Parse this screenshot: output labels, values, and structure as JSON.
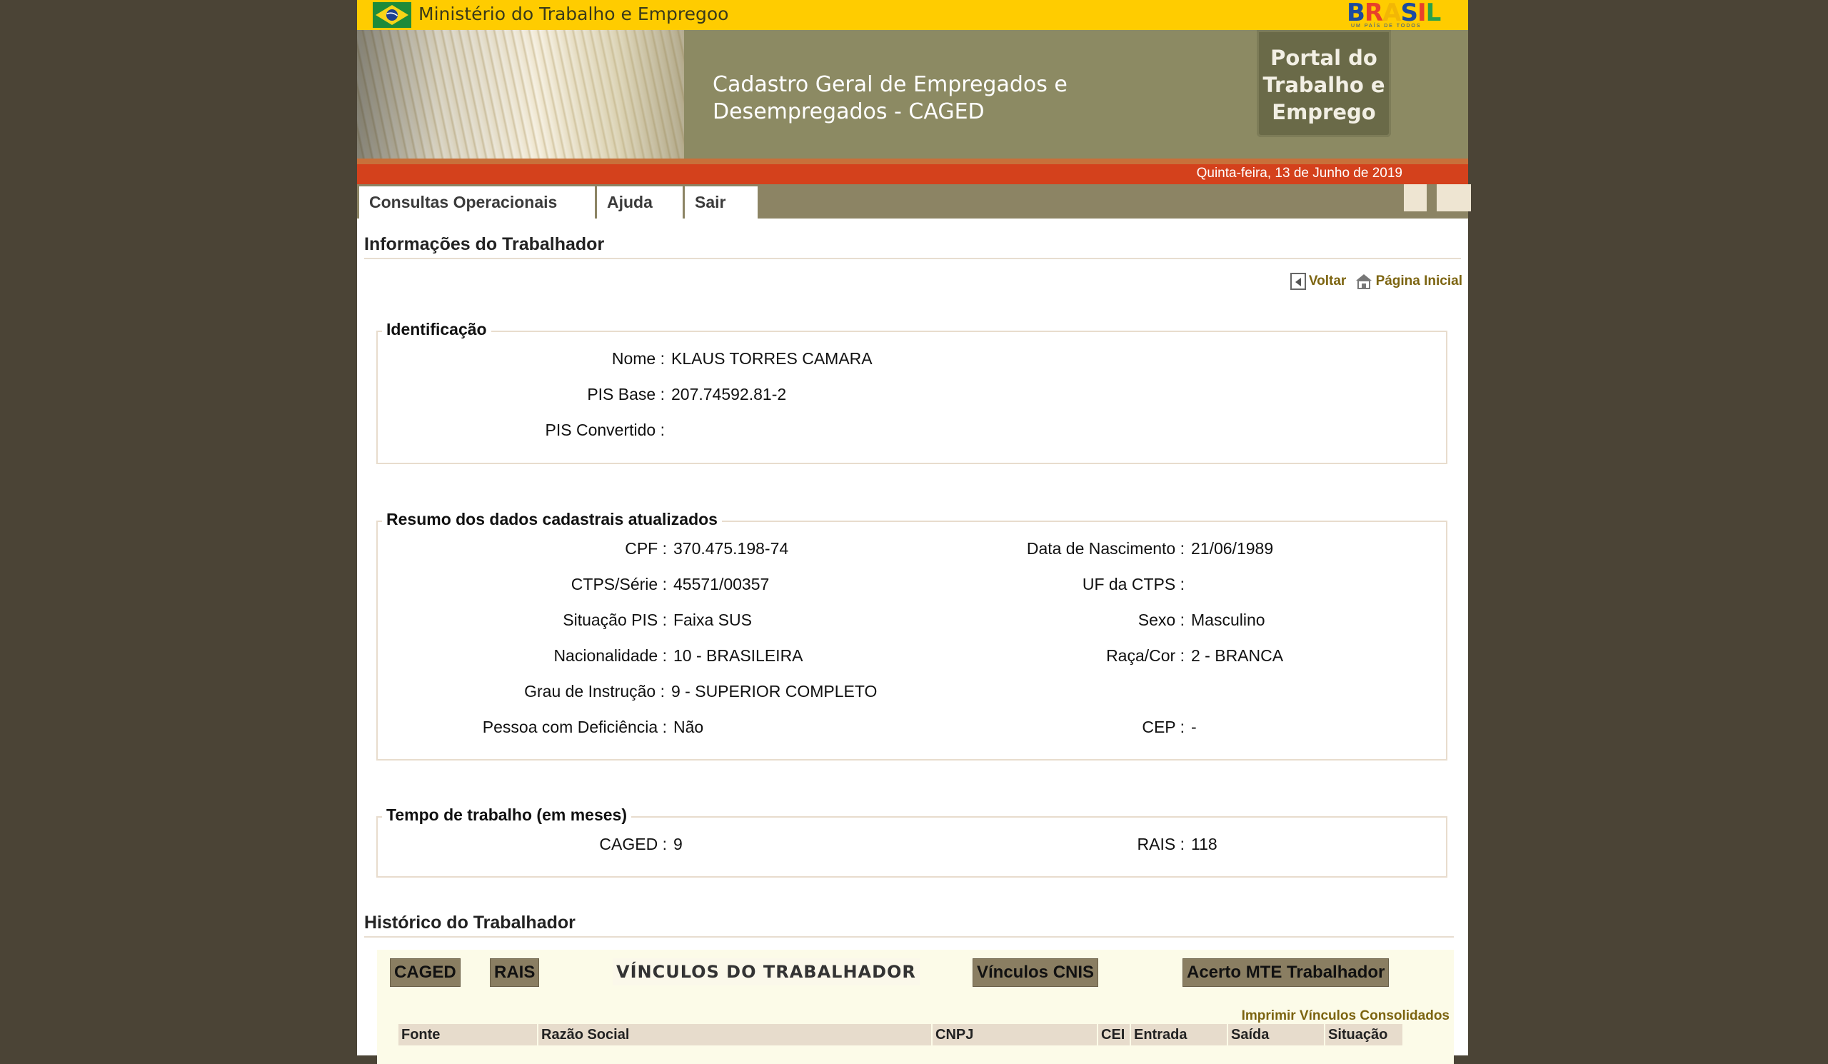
{
  "gov_bar": {
    "ministry": "Ministério do Trabalho e Empregoo",
    "brasil_logo": "BRASIL",
    "brasil_tagline": "UM PAÍS DE TODOS"
  },
  "header": {
    "system_title": "Cadastro Geral de Empregados e Desempregados - CAGED",
    "portal_label": "Portal do\nTrabalho e\nEmprego",
    "date": "Quinta-feira, 13 de Junho de 2019"
  },
  "menu": {
    "items": [
      "Consultas Operacionais",
      "Ajuda",
      "Sair"
    ]
  },
  "page": {
    "title": "Informações do Trabalhador",
    "back_label": "Voltar",
    "home_label": "Página Inicial"
  },
  "identificacao": {
    "legend": "Identificação",
    "fields": [
      {
        "label": "Nome :",
        "value": "KLAUS TORRES CAMARA"
      },
      {
        "label": "PIS Base :",
        "value": "207.74592.81-2"
      },
      {
        "label": "PIS Convertido :",
        "value": ""
      }
    ]
  },
  "resumo": {
    "legend": "Resumo dos dados cadastrais atualizados",
    "left": [
      {
        "label": "CPF :",
        "value": "370.475.198-74"
      },
      {
        "label": "CTPS/Série :",
        "value": "45571/00357"
      },
      {
        "label": "Situação PIS :",
        "value": "Faixa SUS"
      },
      {
        "label": "Nacionalidade :",
        "value": "10 - BRASILEIRA"
      },
      {
        "label": "Grau de Instrução :",
        "value": "9 - SUPERIOR COMPLETO"
      },
      {
        "label": "Pessoa com Deficiência :",
        "value": "Não"
      }
    ],
    "right": [
      {
        "label": "Data de Nascimento :",
        "value": "21/06/1989"
      },
      {
        "label": "UF da CTPS :",
        "value": ""
      },
      {
        "label": "Sexo :",
        "value": "Masculino"
      },
      {
        "label": "Raça/Cor :",
        "value": "2 - BRANCA"
      },
      {
        "label": "CEP :",
        "value": "-"
      }
    ]
  },
  "tempo": {
    "legend": "Tempo de trabalho (em meses)",
    "caged_label": "CAGED :",
    "caged_value": "9",
    "rais_label": "RAIS :",
    "rais_value": "118"
  },
  "historico": {
    "title": "Histórico do Trabalhador",
    "tabs": [
      "CAGED",
      "RAIS",
      "VÍNCULOS DO TRABALHADOR",
      "Vínculos CNIS",
      "Acerto MTE Trabalhador"
    ],
    "print_label": "Imprimir Vínculos Consolidados",
    "columns": [
      "Fonte",
      "Razão Social",
      "CNPJ",
      "CEI",
      "Entrada",
      "Saída",
      "Situação"
    ]
  },
  "colors": {
    "gov_yellow": "#ffcc00",
    "header_olive": "#8c8a63",
    "date_red": "#d4411c",
    "link_gold": "#7c6410"
  }
}
